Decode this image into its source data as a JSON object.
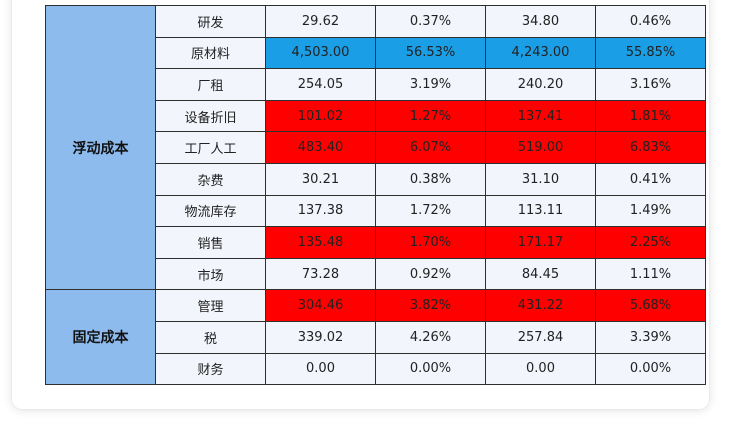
{
  "colors": {
    "group_bg": "#8ebbee",
    "cell_bg": "#f2f6fc",
    "highlight_blue": "#1a9ee6",
    "highlight_red": "#ff0000",
    "border": "#2f2f2f"
  },
  "groups": [
    {
      "label": "浮动成本",
      "rows": 9
    },
    {
      "label": "固定成本",
      "rows": 3
    }
  ],
  "rows": [
    {
      "item": "研发",
      "values": [
        "29.62",
        "0.37%",
        "34.80",
        "0.46%"
      ],
      "highlight": "none"
    },
    {
      "item": "原材料",
      "values": [
        "4,503.00",
        "56.53%",
        "4,243.00",
        "55.85%"
      ],
      "highlight": "blue"
    },
    {
      "item": "厂租",
      "values": [
        "254.05",
        "3.19%",
        "240.20",
        "3.16%"
      ],
      "highlight": "none"
    },
    {
      "item": "设备折旧",
      "values": [
        "101.02",
        "1.27%",
        "137.41",
        "1.81%"
      ],
      "highlight": "red"
    },
    {
      "item": "工厂人工",
      "values": [
        "483.40",
        "6.07%",
        "519.00",
        "6.83%"
      ],
      "highlight": "red"
    },
    {
      "item": "杂费",
      "values": [
        "30.21",
        "0.38%",
        "31.10",
        "0.41%"
      ],
      "highlight": "none"
    },
    {
      "item": "物流库存",
      "values": [
        "137.38",
        "1.72%",
        "113.11",
        "1.49%"
      ],
      "highlight": "none"
    },
    {
      "item": "销售",
      "values": [
        "135.48",
        "1.70%",
        "171.17",
        "2.25%"
      ],
      "highlight": "red"
    },
    {
      "item": "市场",
      "values": [
        "73.28",
        "0.92%",
        "84.45",
        "1.11%"
      ],
      "highlight": "none"
    },
    {
      "item": "管理",
      "values": [
        "304.46",
        "3.82%",
        "431.22",
        "5.68%"
      ],
      "highlight": "red"
    },
    {
      "item": "税",
      "values": [
        "339.02",
        "4.26%",
        "257.84",
        "3.39%"
      ],
      "highlight": "none"
    },
    {
      "item": "财务",
      "values": [
        "0.00",
        "0.00%",
        "0.00",
        "0.00%"
      ],
      "highlight": "none"
    }
  ]
}
